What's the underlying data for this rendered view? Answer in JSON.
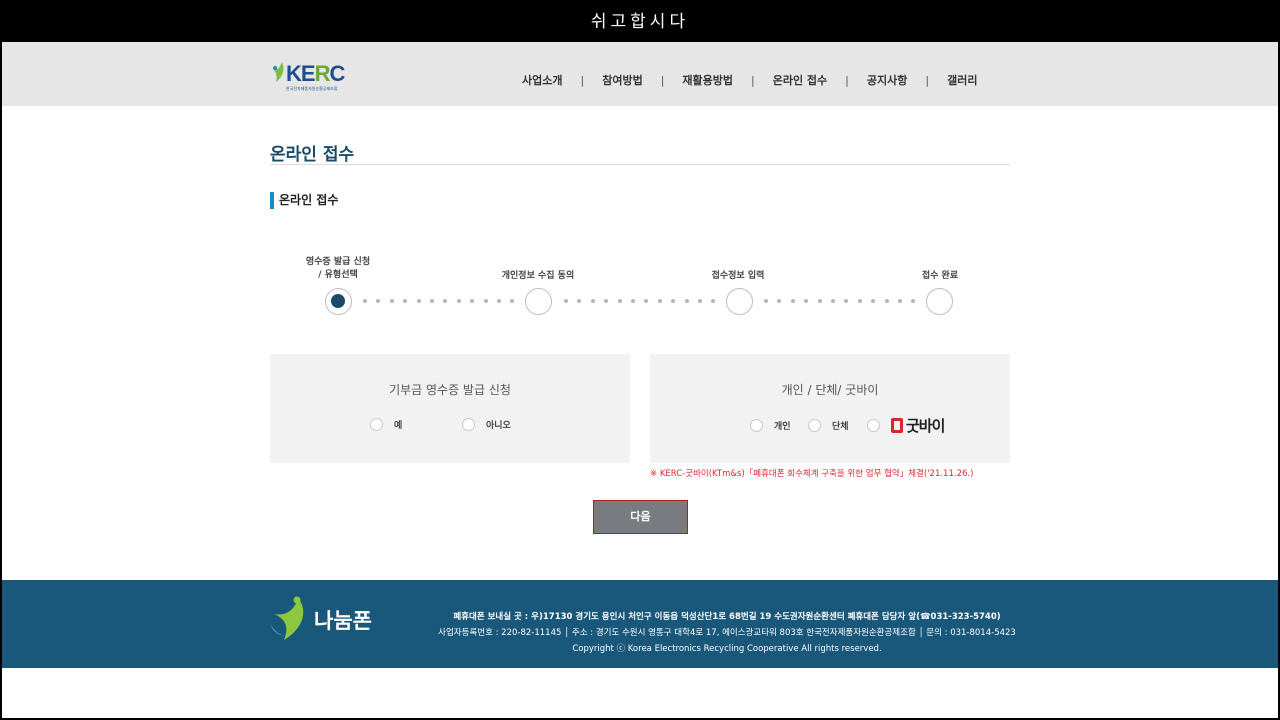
{
  "window": {
    "title": "쉬고합시다"
  },
  "header": {
    "logo": {
      "text_main": "KE",
      "text_accent": "R",
      "text_end": "C",
      "subtext": "한국전자제품자원순환공제조합"
    },
    "nav": [
      "사업소개",
      "참여방법",
      "재활용방법",
      "온라인 접수",
      "공지사항",
      "갤러리"
    ]
  },
  "page": {
    "title": "온라인 접수",
    "section_title": "온라인 접수"
  },
  "steps": [
    {
      "label_line1": "영수증 발급 신청",
      "label_line2": "/ 유형선택",
      "active": true
    },
    {
      "label_line1": "개인정보 수집 동의",
      "label_line2": "",
      "active": false
    },
    {
      "label_line1": "접수정보 입력",
      "label_line2": "",
      "active": false
    },
    {
      "label_line1": "접수 완료",
      "label_line2": "",
      "active": false
    }
  ],
  "receipt_card": {
    "title": "기부금 영수증 발급 신청",
    "options": [
      "예",
      "아니오"
    ]
  },
  "type_card": {
    "title": "개인 / 단체/ 굿바이",
    "options": [
      "개인",
      "단체"
    ],
    "goodbye_logo": "굿바이"
  },
  "notice": "※ KERC-굿바이(KTm&s)「폐휴대폰 회수체계 구축을 위한 업무 협약」체결('21.11.26.)",
  "next_button": "다음",
  "footer": {
    "logo_text": "나눔폰",
    "line1": "폐휴대폰 보내실 곳 : 우)17130 경기도 용인시 처인구 이동읍 덕성산단1로 68번길 19 수도권자원순환센터 폐휴대폰 담당자 앞(☎031-323-5740)",
    "line2": "사업자등록번호 : 220-82-11145 │ 주소 : 경기도 수원시 영통구 대학4로 17, 에이스광교타워 803호 한국전자제품자원순환공제조합 │ 문의 : 031-8014-5423",
    "line3": "Copyright ⓒ Korea Electronics Recycling Cooperative All rights reserved."
  },
  "colors": {
    "primary": "#1b4a6b",
    "accent": "#1a8bc4",
    "footer_bg": "#19587a",
    "notice": "#e1262e"
  }
}
